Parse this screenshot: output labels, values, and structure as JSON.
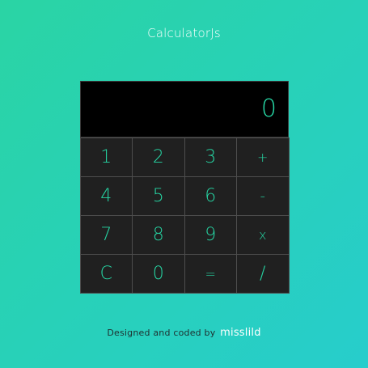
{
  "header": {
    "title": "CalculatorJs"
  },
  "display": {
    "value": "0"
  },
  "keys": [
    {
      "label": "1",
      "name": "key-1"
    },
    {
      "label": "2",
      "name": "key-2"
    },
    {
      "label": "3",
      "name": "key-3"
    },
    {
      "label": "+",
      "name": "key-plus"
    },
    {
      "label": "4",
      "name": "key-4"
    },
    {
      "label": "5",
      "name": "key-5"
    },
    {
      "label": "6",
      "name": "key-6"
    },
    {
      "label": "-",
      "name": "key-minus"
    },
    {
      "label": "7",
      "name": "key-7"
    },
    {
      "label": "8",
      "name": "key-8"
    },
    {
      "label": "9",
      "name": "key-9"
    },
    {
      "label": "x",
      "name": "key-multiply"
    },
    {
      "label": "C",
      "name": "key-clear"
    },
    {
      "label": "0",
      "name": "key-0"
    },
    {
      "label": "=",
      "name": "key-equals"
    },
    {
      "label": "/",
      "name": "key-divide"
    }
  ],
  "footer": {
    "text": "Designed and coded by",
    "author": "misslild"
  },
  "colors": {
    "accent": "#26d6a4",
    "display_bg": "#000000",
    "key_bg": "#202020",
    "gradient_start": "#2ad4a4",
    "gradient_end": "#27cdcc"
  }
}
